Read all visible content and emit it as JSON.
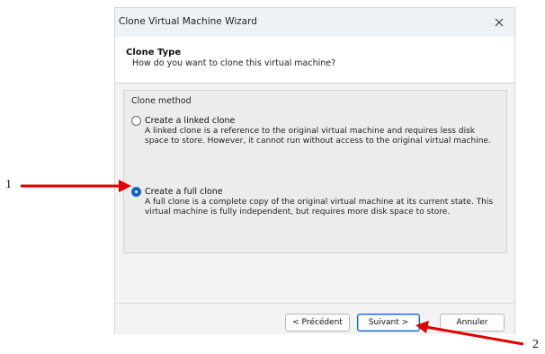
{
  "window": {
    "title": "Clone Virtual Machine Wizard",
    "close_glyph": "×"
  },
  "header": {
    "title": "Clone Type",
    "subtitle": "How do you want to clone this virtual machine?"
  },
  "clone_method": {
    "label": "Clone method",
    "options": [
      {
        "label": "Create a linked clone",
        "selected": false,
        "description": "A linked clone is a reference to the original virtual machine and requires less disk space to store. However, it cannot run without access to the original virtual machine."
      },
      {
        "label": "Create a full clone",
        "selected": true,
        "description": "A full clone is a complete copy of the original virtual machine at its current state. This virtual machine is fully independent, but requires more disk space to store."
      }
    ]
  },
  "buttons": {
    "back": "< Précédent",
    "next": "Suivant >",
    "cancel": "Annuler"
  },
  "annotations": {
    "callout_1": "1",
    "callout_2": "2",
    "arrow_color": "#e00000"
  },
  "colors": {
    "accent": "#1464c8",
    "arrow": "#e00000"
  }
}
